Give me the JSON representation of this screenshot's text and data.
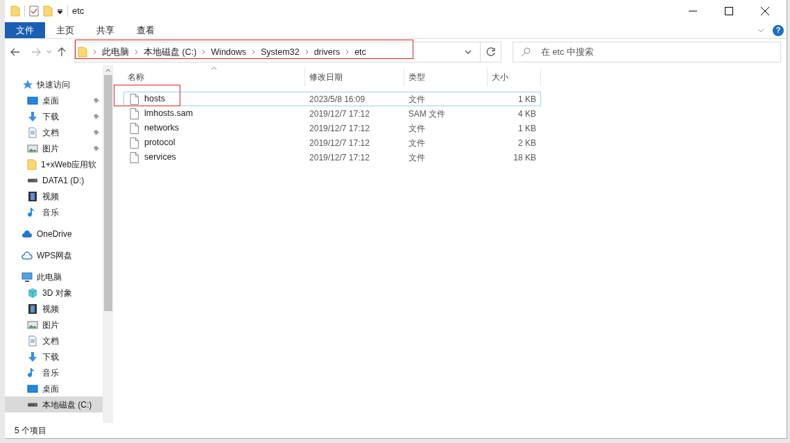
{
  "window": {
    "title": "etc"
  },
  "ribbon_tabs": [
    {
      "label": "文件",
      "selected": true
    },
    {
      "label": "主页",
      "selected": false
    },
    {
      "label": "共享",
      "selected": false
    },
    {
      "label": "查看",
      "selected": false
    }
  ],
  "help": "?",
  "address_bar": {
    "highlighted": true,
    "segments": [
      "此电脑",
      "本地磁盘 (C:)",
      "Windows",
      "System32",
      "drivers",
      "etc"
    ]
  },
  "search": {
    "placeholder": "在 etc 中搜索"
  },
  "sidebar": {
    "items": [
      {
        "label": "快速访问",
        "kind": "star",
        "pinned": false,
        "selected": false,
        "children": [
          {
            "label": "桌面",
            "kind": "desktop",
            "pinned": true,
            "selected": false
          },
          {
            "label": "下载",
            "kind": "download",
            "pinned": true,
            "selected": false
          },
          {
            "label": "文档",
            "kind": "document",
            "pinned": true,
            "selected": false
          },
          {
            "label": "图片",
            "kind": "image",
            "pinned": true,
            "selected": false
          },
          {
            "label": "1+xWeb应用软",
            "kind": "folder",
            "pinned": false,
            "selected": false
          },
          {
            "label": "DATA1 (D:)",
            "kind": "drive",
            "pinned": false,
            "selected": false
          },
          {
            "label": "视频",
            "kind": "video",
            "pinned": false,
            "selected": false
          },
          {
            "label": "音乐",
            "kind": "music",
            "pinned": false,
            "selected": false
          }
        ]
      },
      {
        "label": "OneDrive",
        "kind": "cloud",
        "pinned": false,
        "selected": false
      },
      {
        "label": "WPS网盘",
        "kind": "cloud-outline",
        "pinned": false,
        "selected": false
      },
      {
        "label": "此电脑",
        "kind": "pc",
        "pinned": false,
        "selected": false,
        "children": [
          {
            "label": "3D 对象",
            "kind": "cube",
            "pinned": false,
            "selected": false
          },
          {
            "label": "视频",
            "kind": "video",
            "pinned": false,
            "selected": false
          },
          {
            "label": "图片",
            "kind": "image",
            "pinned": false,
            "selected": false
          },
          {
            "label": "文档",
            "kind": "document",
            "pinned": false,
            "selected": false
          },
          {
            "label": "下载",
            "kind": "download",
            "pinned": false,
            "selected": false
          },
          {
            "label": "音乐",
            "kind": "music",
            "pinned": false,
            "selected": false
          },
          {
            "label": "桌面",
            "kind": "desktop",
            "pinned": false,
            "selected": false
          },
          {
            "label": "本地磁盘 (C:)",
            "kind": "drive",
            "pinned": false,
            "selected": true
          }
        ]
      }
    ]
  },
  "table": {
    "columns": [
      "名称",
      "修改日期",
      "类型",
      "大小"
    ],
    "rows": [
      {
        "name": "hosts",
        "date": "2023/5/8 16:09",
        "type": "文件",
        "size": "1 KB",
        "selected": true,
        "highlighted": true
      },
      {
        "name": "lmhosts.sam",
        "date": "2019/12/7 17:12",
        "type": "SAM 文件",
        "size": "4 KB",
        "selected": false,
        "highlighted": false
      },
      {
        "name": "networks",
        "date": "2019/12/7 17:12",
        "type": "文件",
        "size": "1 KB",
        "selected": false,
        "highlighted": false
      },
      {
        "name": "protocol",
        "date": "2019/12/7 17:12",
        "type": "文件",
        "size": "2 KB",
        "selected": false,
        "highlighted": false
      },
      {
        "name": "services",
        "date": "2019/12/7 17:12",
        "type": "文件",
        "size": "18 KB",
        "selected": false,
        "highlighted": false
      }
    ]
  },
  "status_bar": "5 个项目"
}
